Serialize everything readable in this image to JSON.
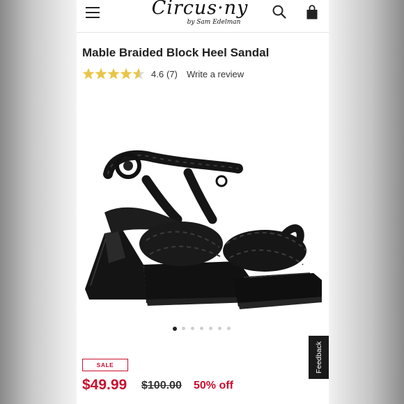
{
  "header": {
    "logo_main": "Circus·ny",
    "logo_sub": "by Sam Edelman"
  },
  "product": {
    "title": "Mable Braided Block Heel Sandal",
    "rating": "4.6",
    "rating_value": 4.6,
    "rating_max": 5,
    "review_count": "(7)",
    "write_review": "Write a review",
    "image_alt": "Black braided block heel platform sandal with ankle strap"
  },
  "carousel": {
    "count": 7,
    "active_index": 0
  },
  "pricing": {
    "badge": "SALE",
    "sale_price": "$49.99",
    "original_price": "$100.00",
    "discount": "50% off"
  },
  "feedback": {
    "label": "Feedback"
  },
  "colors": {
    "accent_red": "#c8102e",
    "star_gold": "#e8c547",
    "text_dark": "#222222"
  }
}
